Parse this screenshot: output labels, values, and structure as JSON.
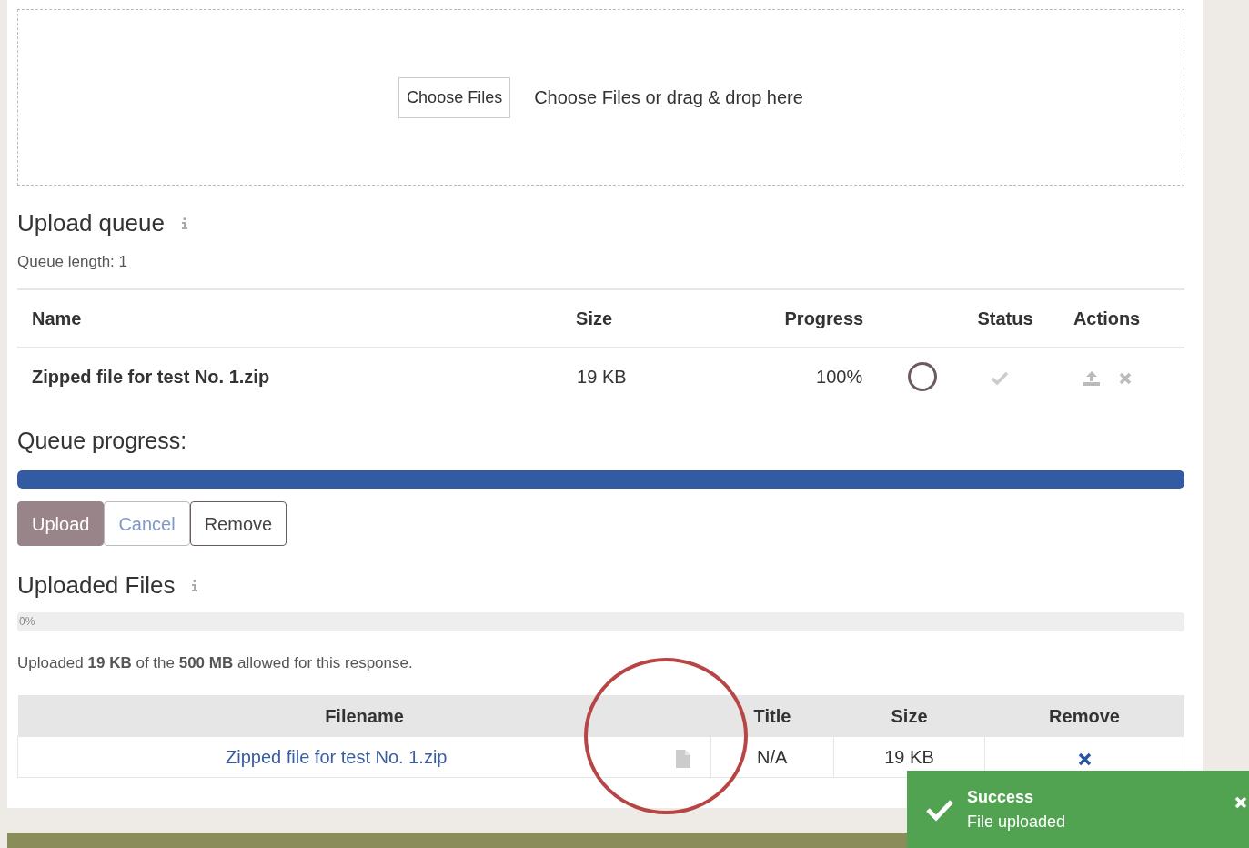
{
  "dropzone": {
    "button": "Choose Files",
    "hint": "Choose Files or drag & drop here"
  },
  "upload_queue": {
    "title": "Upload queue",
    "length_label": "Queue length: 1",
    "columns": [
      "Name",
      "Size",
      "Progress",
      "Status",
      "Actions"
    ],
    "rows": [
      {
        "name": "Zipped file for test No. 1.zip",
        "size": "19 KB",
        "progress": "100%"
      }
    ]
  },
  "queue_progress": {
    "label": "Queue progress:",
    "level": 1
  },
  "buttons": [
    {
      "label": "Upload",
      "kind": "primary"
    },
    {
      "label": "Cancel",
      "kind": "secondary"
    },
    {
      "label": "Remove",
      "kind": "outline"
    }
  ],
  "uploaded": {
    "title": "Uploaded Files",
    "percent": "0%",
    "summary": "Uploaded **19 KB** of the **500 MB** allowed for this response.",
    "columns": [
      "Filename",
      "Title",
      "Size",
      "Remove"
    ],
    "rows": [
      {
        "filename": "Zipped file for test No. 1.zip",
        "title": "N/A",
        "size": "19 KB"
      }
    ]
  },
  "toast": {
    "title": "Success",
    "message": "File uploaded"
  }
}
